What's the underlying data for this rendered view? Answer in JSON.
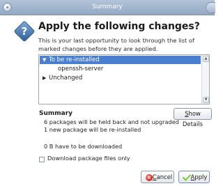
{
  "window": {
    "title": "Summary"
  },
  "dialog": {
    "heading": "Apply the following changes?",
    "description": "This is your last opportunity to look through the list of marked changes before they are applied."
  },
  "tree": {
    "items": [
      {
        "label": "To be re-installed",
        "expanded": true,
        "selected": true,
        "level": 0
      },
      {
        "label": "openssh-server",
        "expanded": false,
        "selected": false,
        "level": 1
      },
      {
        "label": "Unchanged",
        "expanded": false,
        "selected": false,
        "level": 0
      }
    ]
  },
  "summary": {
    "title": "Summary",
    "line1": "6 packages will be held back and not upgraded",
    "line2": "1 new package will be re-installed",
    "download": "0  B have to be downloaded"
  },
  "buttons": {
    "show_details_underline": "S",
    "show_details_rest": "how Details",
    "cancel_underline": "C",
    "cancel_rest": "ancel",
    "apply_underline": "A",
    "apply_rest": "pply"
  },
  "options": {
    "download_only_label": "Download package files only",
    "download_only_checked": false
  },
  "colors": {
    "title_bar": "#93a9c4",
    "selection": "#4a7ecf",
    "question_icon": "#2f5f98",
    "cancel_icon": "#d0281c",
    "apply_icon": "#7ac943"
  },
  "icons": {
    "window": "app-icon",
    "question": "question-icon",
    "cancel": "cancel-icon",
    "apply": "checkmark-icon"
  }
}
